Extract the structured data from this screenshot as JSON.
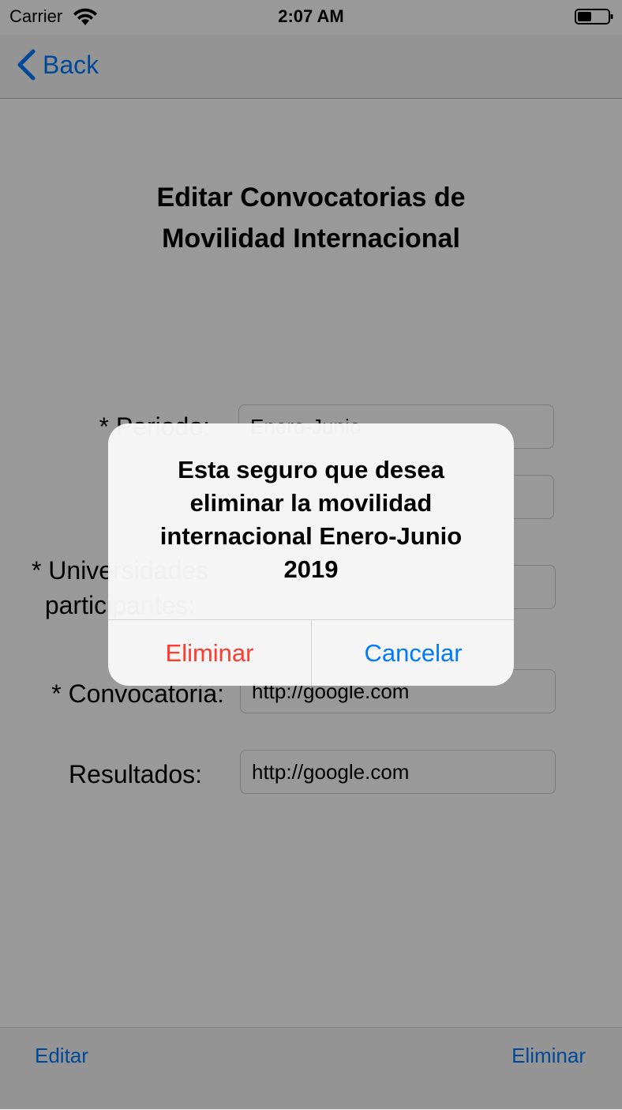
{
  "status_bar": {
    "carrier": "Carrier",
    "time": "2:07 AM"
  },
  "nav": {
    "back_label": "Back"
  },
  "page": {
    "title_line1": "Editar Convocatorias de",
    "title_line2": "Movilidad Internacional"
  },
  "form": {
    "periodo_label": "* Periodo:",
    "periodo_value": "Enero-Junio",
    "universidad_label_line1": "* Universidades",
    "universidad_label_line2": "participantes:",
    "convocatoria_label": "* Convocatoria:",
    "convocatoria_value": "http://google.com",
    "resultados_label": "Resultados:",
    "resultados_value": "http://google.com"
  },
  "toolbar": {
    "edit_label": "Editar",
    "delete_label": "Eliminar"
  },
  "alert": {
    "message": "Esta seguro que desea eliminar la movilidad internacional Enero-Junio 2019",
    "destructive_label": "Eliminar",
    "cancel_label": "Cancelar"
  },
  "colors": {
    "tint": "#007aff",
    "destructive": "#ff3b30",
    "overlay": "rgba(0,0,0,0.40)"
  }
}
